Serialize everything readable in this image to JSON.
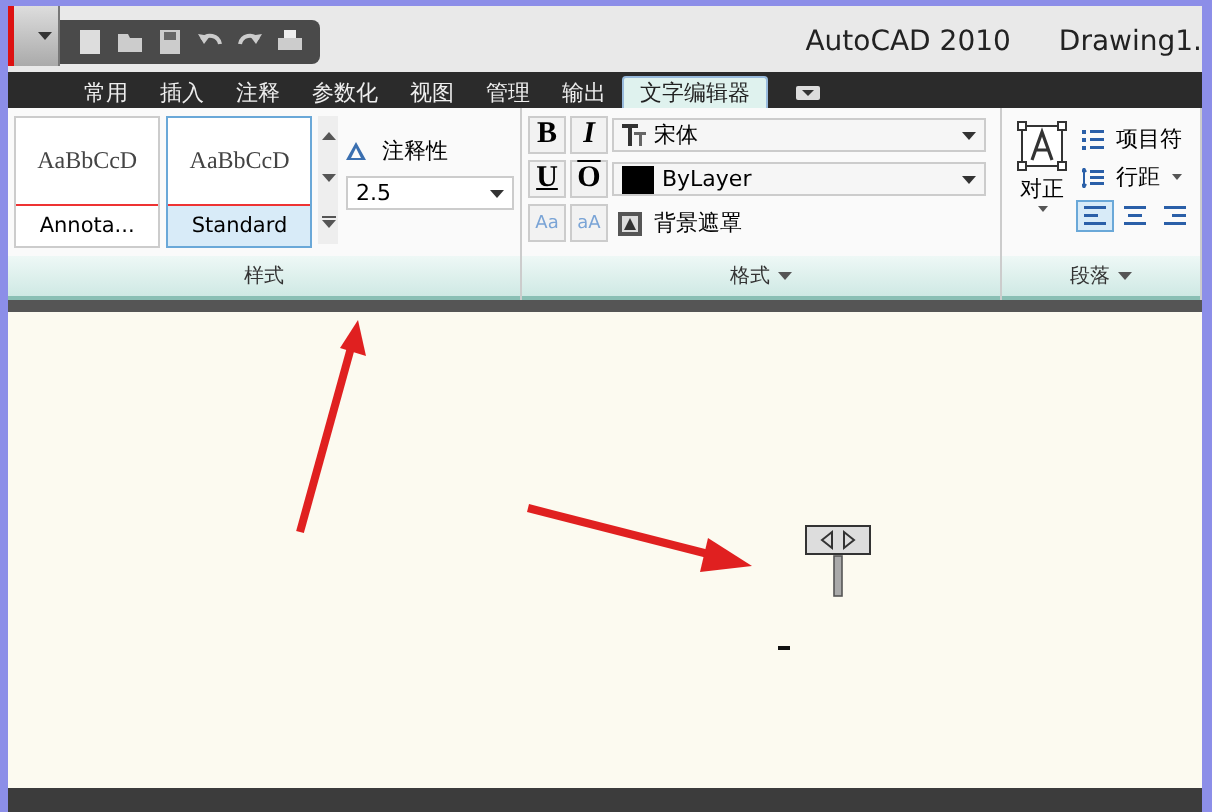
{
  "window": {
    "app_title": "AutoCAD 2010",
    "document_title": "Drawing1."
  },
  "tabs": [
    {
      "label": "常用",
      "selected": false
    },
    {
      "label": "插入",
      "selected": false
    },
    {
      "label": "注释",
      "selected": false
    },
    {
      "label": "参数化",
      "selected": false
    },
    {
      "label": "视图",
      "selected": false
    },
    {
      "label": "管理",
      "selected": false
    },
    {
      "label": "输出",
      "selected": false
    },
    {
      "label": "文字编辑器",
      "selected": true
    }
  ],
  "style_panel": {
    "title": "样式",
    "styles": [
      {
        "preview": "AaBbCcD",
        "name": "Annota...",
        "selected": false
      },
      {
        "preview": "AaBbCcD",
        "name": "Standard",
        "selected": true
      }
    ],
    "annotative_label": "注释性",
    "height_value": "2.5"
  },
  "format_panel": {
    "title": "格式",
    "bold": "B",
    "italic": "I",
    "underline": "U",
    "overline": "O",
    "font": "宋体",
    "color_name": "ByLayer",
    "color": "#000000",
    "case_upper": "Aa",
    "case_lower": "aA",
    "background_mask": "背景遮罩"
  },
  "paragraph_panel": {
    "title": "段落",
    "justify_label": "对正",
    "bullets_label": "项目符",
    "line_spacing_label": "行距"
  }
}
